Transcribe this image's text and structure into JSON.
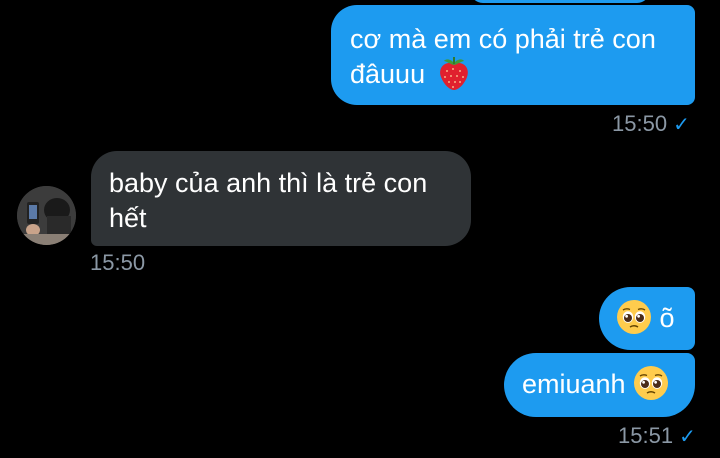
{
  "messages": [
    {
      "id": "m1",
      "direction": "outgoing",
      "text": "cơ mà em có phải trẻ con đâuuu",
      "emoji": "strawberry",
      "time": "15:50",
      "read": true
    },
    {
      "id": "m2",
      "direction": "incoming",
      "text": "baby của anh thì là trẻ con hết",
      "time": "15:50"
    },
    {
      "id": "m3",
      "direction": "outgoing",
      "emoji": "pleading-face",
      "text": "õ"
    },
    {
      "id": "m4",
      "direction": "outgoing",
      "text": "emiuanh",
      "emoji": "pleading-face",
      "time": "15:51",
      "read": true
    }
  ],
  "icons": {
    "read_receipt": "✓"
  },
  "colors": {
    "background": "#000000",
    "outgoing_bubble": "#1d9bf0",
    "incoming_bubble": "#2f3336",
    "timestamp": "#8b98a5",
    "read_check": "#1d9bf0"
  }
}
